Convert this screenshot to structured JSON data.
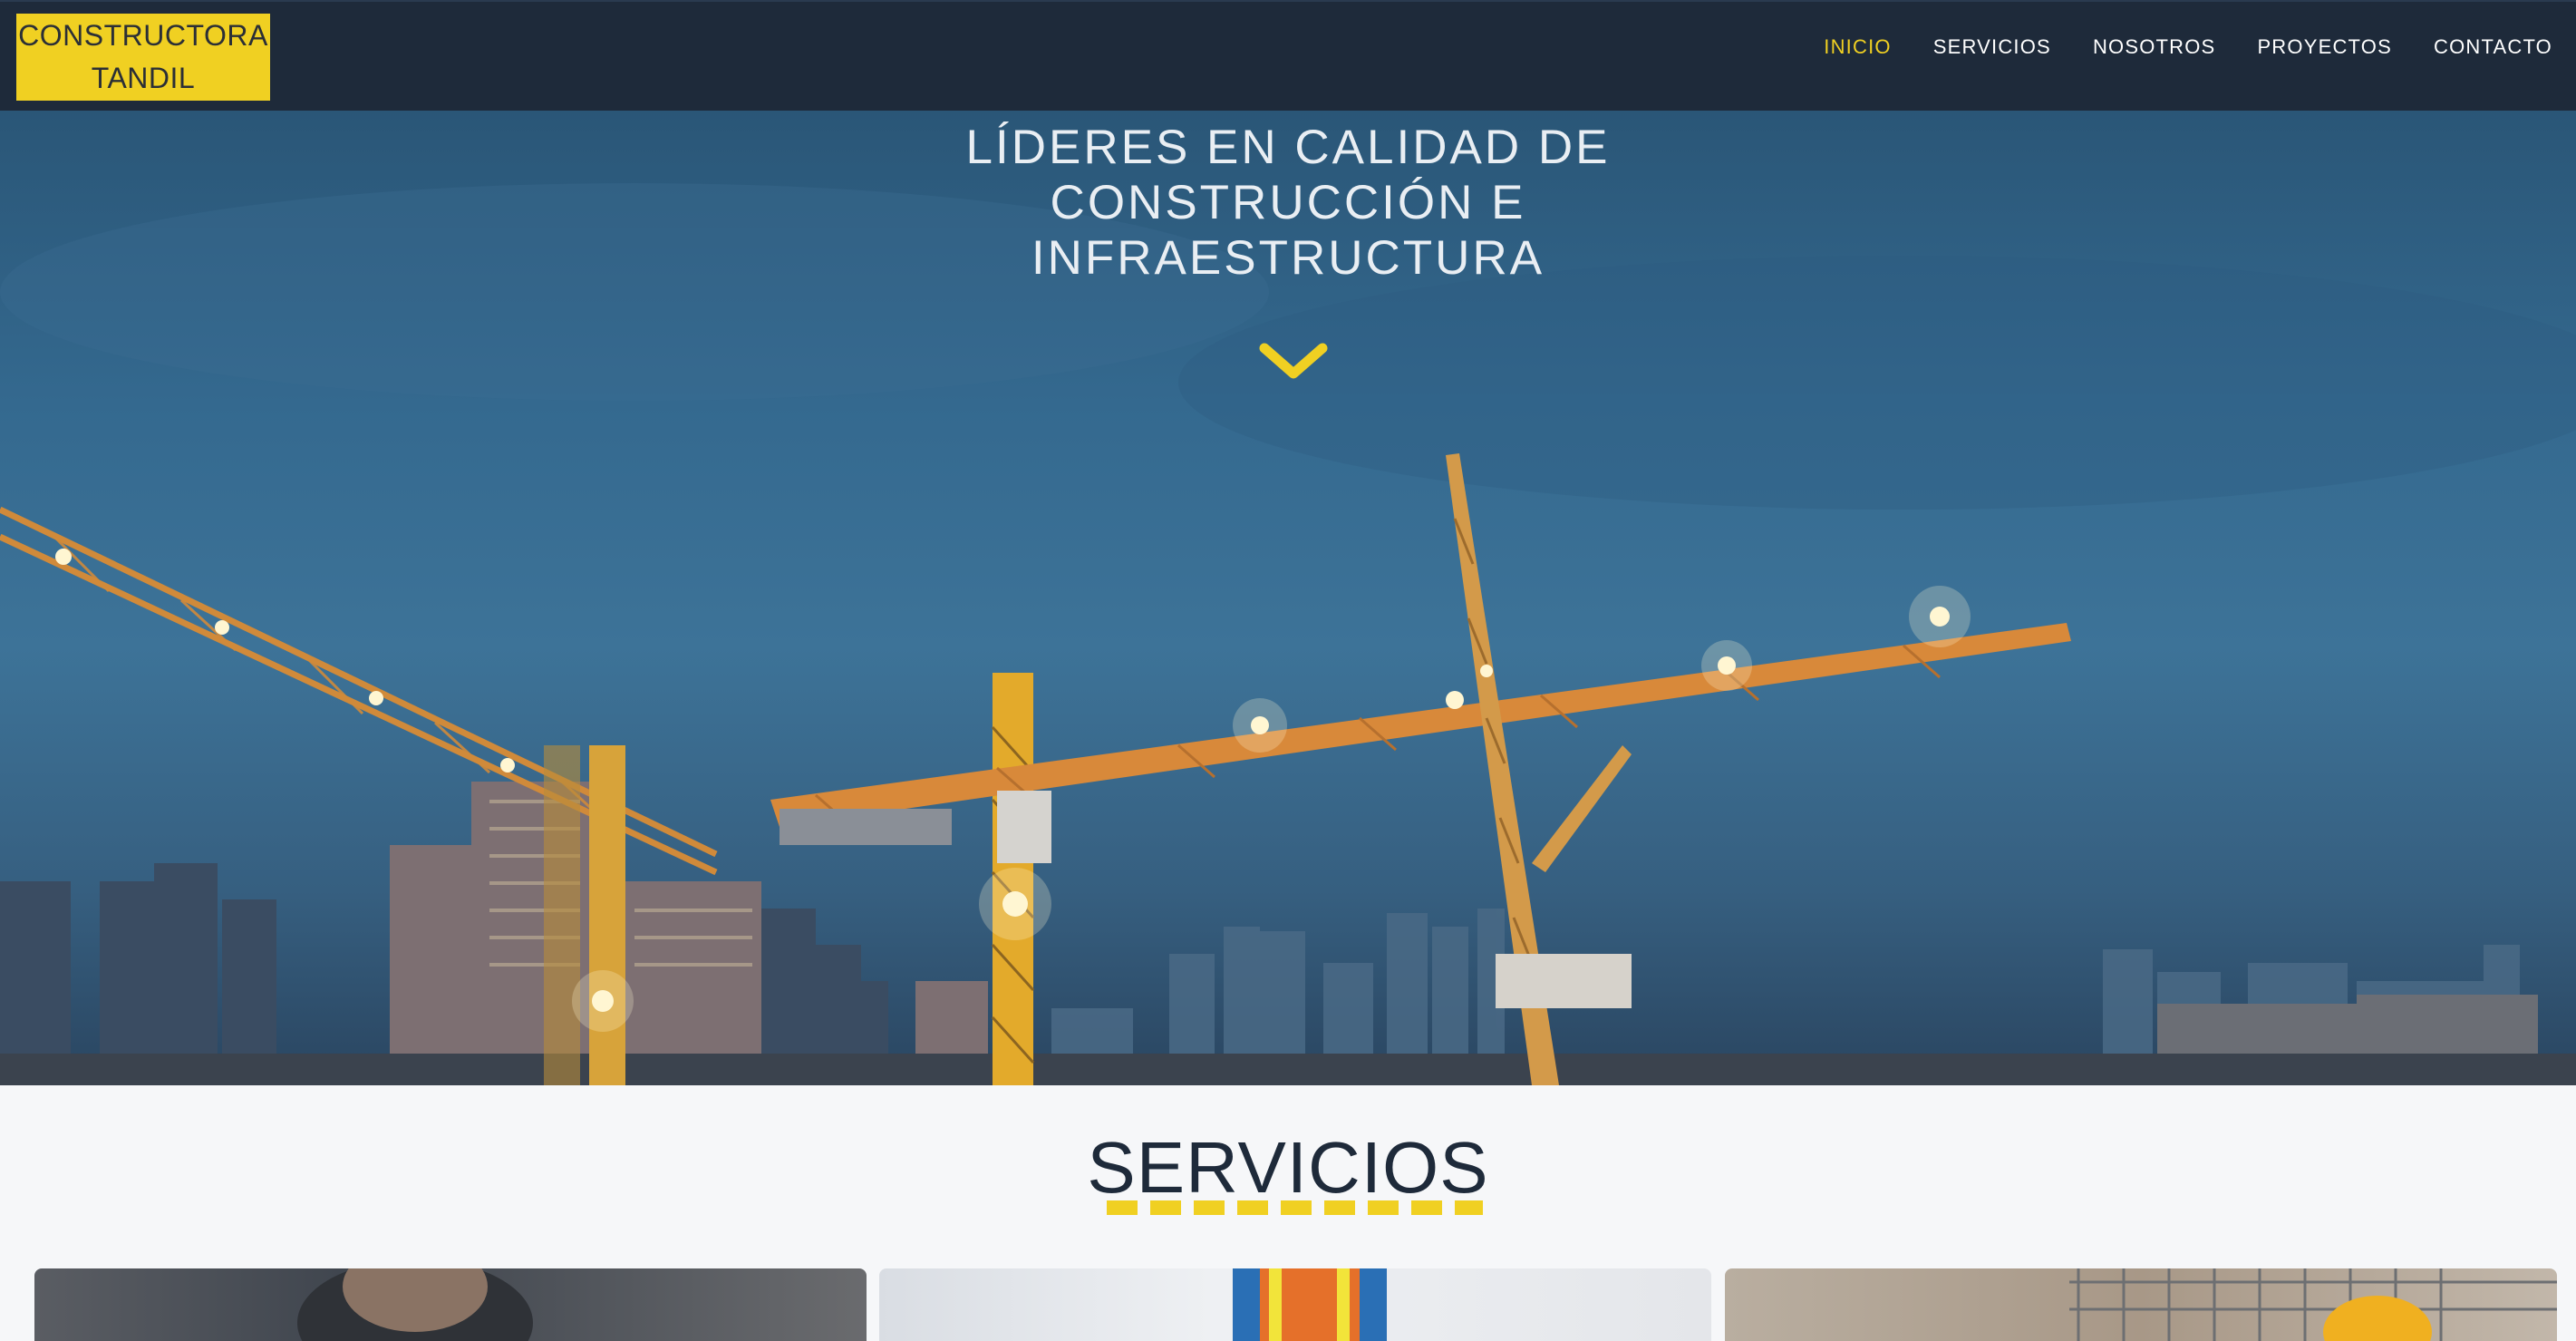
{
  "header": {
    "logo_line1": "CONSTRUCTORA",
    "logo_line2": "TANDIL",
    "nav": [
      {
        "label": "INICIO",
        "active": true
      },
      {
        "label": "SERVICIOS",
        "active": false
      },
      {
        "label": "NOSOTROS",
        "active": false
      },
      {
        "label": "PROYECTOS",
        "active": false
      },
      {
        "label": "CONTACTO",
        "active": false
      }
    ]
  },
  "hero": {
    "title_line1": "LÍDERES EN CALIDAD DE",
    "title_line2": "CONSTRUCCIÓN E",
    "title_line3": "INFRAESTRUCTURA",
    "scroll_icon": "chevron-down-icon"
  },
  "services": {
    "title": "SERVICIOS"
  },
  "colors": {
    "header_bg": "#1e2a3a",
    "accent": "#f0d022",
    "hero_sky": "#34698f"
  }
}
